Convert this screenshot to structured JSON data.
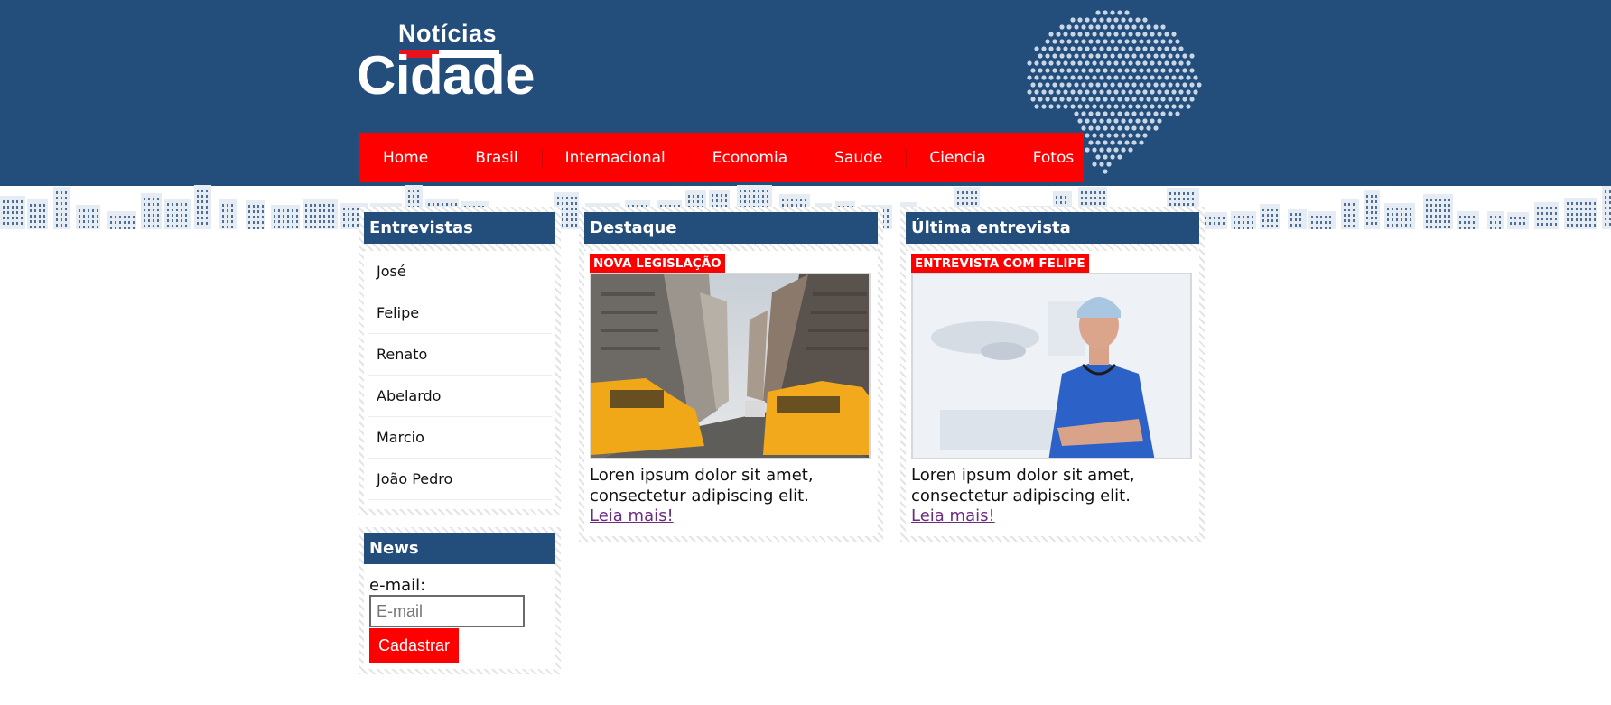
{
  "logo": {
    "top_text": "Notícias",
    "main_text": "Cidade",
    "colors": {
      "text": "#ffffff",
      "accent": "#e8121d"
    }
  },
  "header": {
    "background": "#234d7a",
    "decor": [
      "brazil-map-icon",
      "city-skyline"
    ]
  },
  "nav": {
    "background": "#ff0000",
    "items": [
      "Home",
      "Brasil",
      "Internacional",
      "Economia",
      "Saude",
      "Ciencia",
      "Fotos"
    ]
  },
  "interviews": {
    "title": "Entrevistas",
    "items": [
      "José",
      "Felipe",
      "Renato",
      "Abelardo",
      "Marcio",
      "João Pedro"
    ]
  },
  "newsletter": {
    "title": "News",
    "label": "e-mail:",
    "placeholder": "E-mail",
    "button": "Cadastrar"
  },
  "featured": {
    "title": "Destaque",
    "badge": "NOVA LEGISLAÇÃO",
    "image": "street-taxi-image",
    "text": "Loren ipsum dolor sit amet, consectetur adipiscing elit.",
    "link": "Leia mais!"
  },
  "latest_interview": {
    "title": "Última entrevista",
    "badge": "ENTREVISTA COM FELIPE",
    "image": "surgeon-image",
    "text": "Loren ipsum dolor sit amet, consectetur adipiscing elit.",
    "link": "Leia mais!"
  },
  "colors": {
    "primary": "#234d7a",
    "accent": "#ff0000",
    "link": "#6b2d80"
  }
}
